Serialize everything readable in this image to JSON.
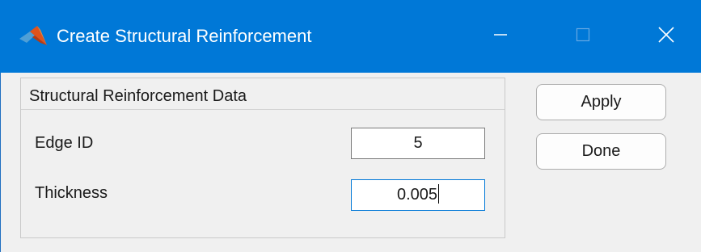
{
  "window": {
    "title": "Create Structural Reinforcement",
    "app_icon": "matlab-logo-icon",
    "controls": {
      "minimize_icon": "minimize-icon",
      "maximize_icon": "maximize-icon",
      "close_icon": "close-icon"
    }
  },
  "panel": {
    "title": "Structural Reinforcement Data",
    "fields": [
      {
        "label": "Edge ID",
        "value": "5"
      },
      {
        "label": "Thickness",
        "value": "0.005"
      }
    ]
  },
  "buttons": {
    "apply_label": "Apply",
    "done_label": "Done"
  },
  "colors": {
    "titlebar": "#0078d7",
    "background": "#f0f0f0",
    "focus_border": "#0078d7"
  }
}
